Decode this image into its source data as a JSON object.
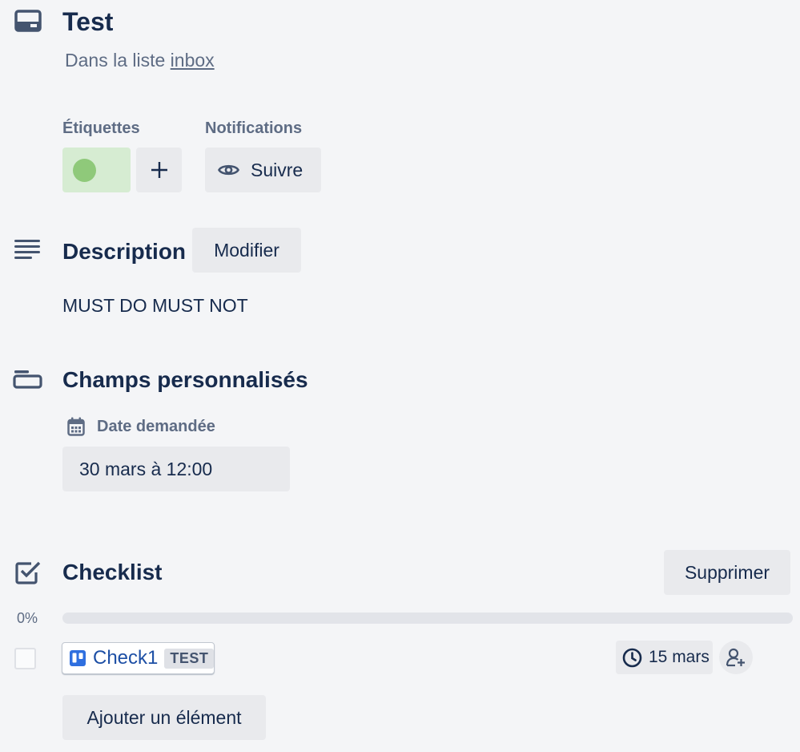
{
  "card": {
    "title": "Test",
    "list_prefix": "Dans la liste ",
    "list_name": "inbox"
  },
  "labels": {
    "heading": "Étiquettes",
    "items": [
      {
        "color": "#8fc97a",
        "background": "#d6ecd2"
      }
    ],
    "add_icon": "plus-icon"
  },
  "notifications": {
    "heading": "Notifications",
    "follow_label": "Suivre",
    "follow_icon": "eye-icon"
  },
  "description": {
    "title": "Description",
    "edit_label": "Modifier",
    "text": "MUST DO MUST NOT",
    "icon": "description-lines-icon"
  },
  "custom_fields": {
    "title": "Champs personnalisés",
    "icon": "custom-fields-icon",
    "fields": [
      {
        "label": "Date demandée",
        "icon": "calendar-icon",
        "value": "30 mars à 12:00"
      }
    ]
  },
  "checklist": {
    "title": "Checklist",
    "icon": "checkbox-icon",
    "delete_label": "Supprimer",
    "progress_text": "0%",
    "progress": 0,
    "progress_color": "#5aac44",
    "items": [
      {
        "name": "Check1",
        "tag": "TEST",
        "checked": false,
        "icon": "trello-board-icon",
        "due": "15 mars",
        "due_icon": "clock-icon",
        "assign_icon": "add-member-icon"
      }
    ],
    "add_item_label": "Ajouter un élément"
  }
}
